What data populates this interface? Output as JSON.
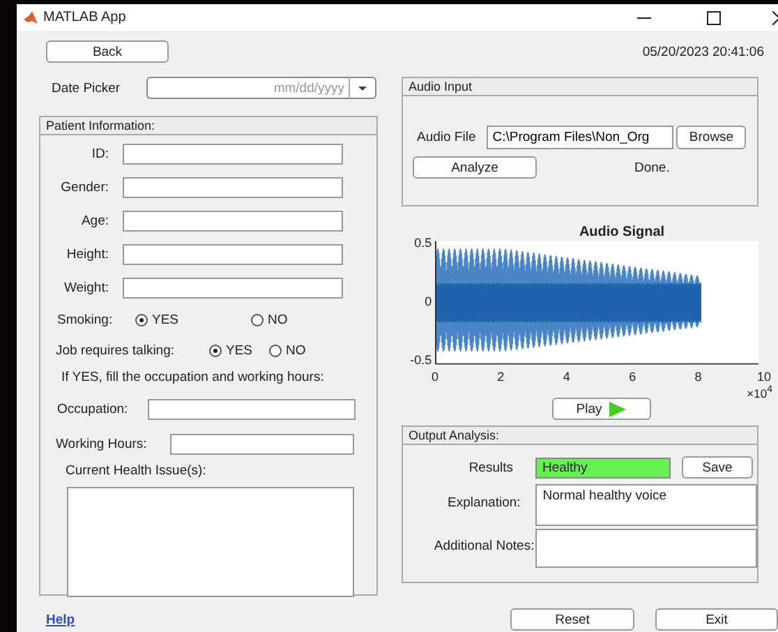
{
  "window": {
    "title": "MATLAB App"
  },
  "back_button": "Back",
  "datetime": "05/20/2023 20:41:06",
  "date_picker": {
    "label": "Date Picker",
    "placeholder": "mm/dd/yyyy"
  },
  "patient_panel": {
    "title": "Patient Information:",
    "fields": [
      {
        "label": "ID:"
      },
      {
        "label": "Gender:"
      },
      {
        "label": "Age:"
      },
      {
        "label": "Height:"
      },
      {
        "label": "Weight:"
      }
    ],
    "smoking": {
      "label": "Smoking:",
      "options": [
        {
          "label": "YES",
          "selected": true
        },
        {
          "label": "NO",
          "selected": false
        }
      ]
    },
    "job_talking": {
      "label": "Job requires talking:",
      "options": [
        {
          "label": "YES",
          "selected": true
        },
        {
          "label": "NO",
          "selected": false
        }
      ]
    },
    "note": "If YES, fill the occupation and working hours:",
    "occupation": {
      "label": "Occupation:"
    },
    "working_hours": {
      "label": "Working Hours:"
    },
    "health_issues": {
      "label": "Current Health Issue(s):"
    }
  },
  "audio_panel": {
    "title": "Audio Input",
    "file_label": "Audio File",
    "file_value": "C:\\Program Files\\Non_Org",
    "browse_button": "Browse",
    "analyze_button": "Analyze",
    "status": "Done."
  },
  "plot": {
    "title": "Audio Signal",
    "yticks": [
      "0.5",
      "0",
      "-0.5"
    ],
    "xticks": [
      "0",
      "2",
      "4",
      "6",
      "8",
      "10"
    ],
    "x_exponent": "×10$^{4}$"
  },
  "play_button": "Play",
  "output_panel": {
    "title": "Output Analysis:",
    "results_label": "Results",
    "result_value": "Healthy",
    "save_button": "Save",
    "explanation_label": "Explanation:",
    "explanation_value": "Normal healthy voice",
    "notes_label": "Additional Notes:"
  },
  "help_link": "Help",
  "reset_button": "Reset",
  "exit_button": "Exit"
}
